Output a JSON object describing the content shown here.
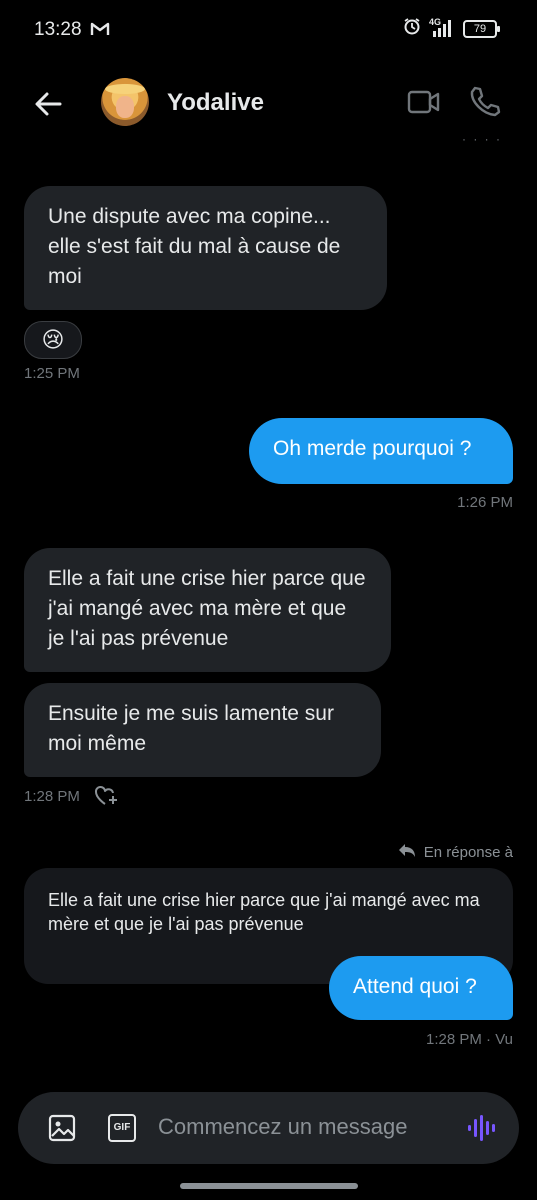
{
  "status_bar": {
    "time": "13:28",
    "network": "4G",
    "battery": "79",
    "icons": [
      "gmail-icon",
      "alarm-icon",
      "signal-icon",
      "battery-icon"
    ]
  },
  "header": {
    "contact_name": "Yodalive",
    "icons": [
      "back-arrow-icon",
      "video-call-icon",
      "phone-icon"
    ]
  },
  "messages": [
    {
      "direction": "received",
      "text": "Une dispute avec ma copine... elle s'est fait du mal à cause de moi",
      "reaction": "😢",
      "time": "1:25 PM"
    },
    {
      "direction": "sent",
      "text": "Oh merde pourquoi ?",
      "time": "1:26 PM"
    },
    {
      "direction": "received",
      "text": "Elle a fait une crise hier parce que j'ai mangé avec ma mère et que je l'ai pas prévenue"
    },
    {
      "direction": "received",
      "text": "Ensuite je me suis lamente sur moi même",
      "time": "1:28 PM"
    },
    {
      "direction": "sent",
      "reply_label": "En réponse à",
      "quoted_text": "Elle a fait une crise hier parce que j'ai mangé avec ma mère et que je l'ai pas prévenue",
      "text": "Attend quoi ?",
      "time": "1:28 PM · Vu"
    }
  ],
  "composer": {
    "placeholder": "Commencez un message",
    "gif_label": "GIF",
    "icons": [
      "image-icon",
      "gif-icon",
      "voice-message-icon"
    ]
  },
  "colors": {
    "background": "#000000",
    "received_bubble": "#202327",
    "sent_bubble": "#1d9bf0",
    "meta_text": "#71767b",
    "voice_icon": "#7856ff"
  }
}
